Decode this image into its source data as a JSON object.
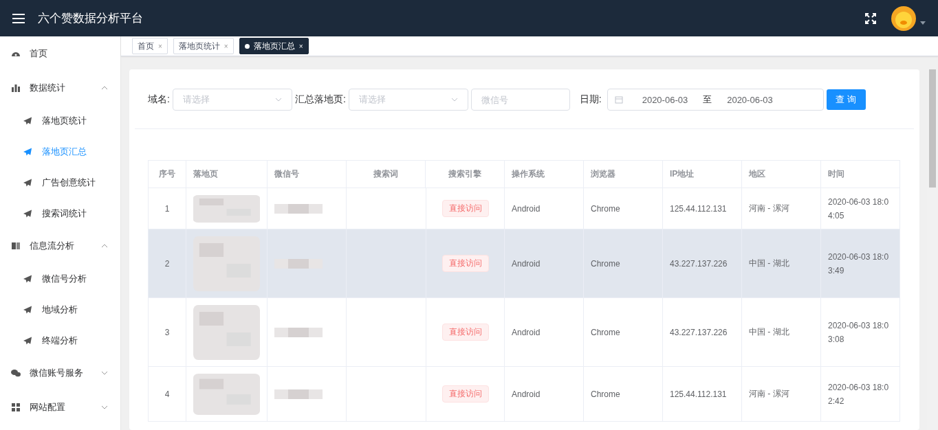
{
  "header": {
    "title": "六个赞数据分析平台"
  },
  "sidebar": {
    "items": [
      {
        "label": "首页"
      },
      {
        "label": "数据统计",
        "expanded": true,
        "children": [
          {
            "label": "落地页统计",
            "selected": false
          },
          {
            "label": "落地页汇总",
            "selected": true
          },
          {
            "label": "广告创意统计",
            "selected": false
          },
          {
            "label": "搜索词统计",
            "selected": false
          }
        ]
      },
      {
        "label": "信息流分析",
        "expanded": true,
        "children": [
          {
            "label": "微信号分析",
            "selected": false
          },
          {
            "label": "地域分析",
            "selected": false
          },
          {
            "label": "终端分析",
            "selected": false
          }
        ]
      },
      {
        "label": "微信账号服务",
        "expanded": false
      },
      {
        "label": "网站配置",
        "expanded": false
      }
    ]
  },
  "tabs": [
    {
      "label": "首页",
      "close": "×",
      "selected": false
    },
    {
      "label": "落地页统计",
      "close": "×",
      "selected": false
    },
    {
      "label": "落地页汇总",
      "close": "×",
      "selected": true
    }
  ],
  "filters": {
    "domain": {
      "label": "域名:",
      "placeholder": "请选择"
    },
    "landing": {
      "label": "汇总落地页:",
      "placeholder": "请选择"
    },
    "wechat": {
      "placeholder": "微信号"
    },
    "date": {
      "label": "日期:",
      "start": "2020-06-03",
      "separator": "至",
      "end": "2020-06-03"
    },
    "button": "查 询"
  },
  "table": {
    "columns": [
      "序号",
      "落地页",
      "微信号",
      "搜索词",
      "搜索引擎",
      "操作系统",
      "浏览器",
      "IP地址",
      "地区",
      "时间"
    ],
    "rows": [
      {
        "index": "1",
        "engine": "直接访问",
        "os": "Android",
        "browser": "Chrome",
        "ip": "125.44.112.131",
        "region": "河南 - 漯河",
        "time": "2020-06-03 18:04:05",
        "highlighted": false
      },
      {
        "index": "2",
        "engine": "直接访问",
        "os": "Android",
        "browser": "Chrome",
        "ip": "43.227.137.226",
        "region": "中国 - 湖北",
        "time": "2020-06-03 18:03:49",
        "highlighted": true
      },
      {
        "index": "3",
        "engine": "直接访问",
        "os": "Android",
        "browser": "Chrome",
        "ip": "43.227.137.226",
        "region": "中国 - 湖北",
        "time": "2020-06-03 18:03:08",
        "highlighted": false
      },
      {
        "index": "4",
        "engine": "直接访问",
        "os": "Android",
        "browser": "Chrome",
        "ip": "125.44.112.131",
        "region": "河南 - 漯河",
        "time": "2020-06-03 18:02:42",
        "highlighted": false
      }
    ]
  }
}
